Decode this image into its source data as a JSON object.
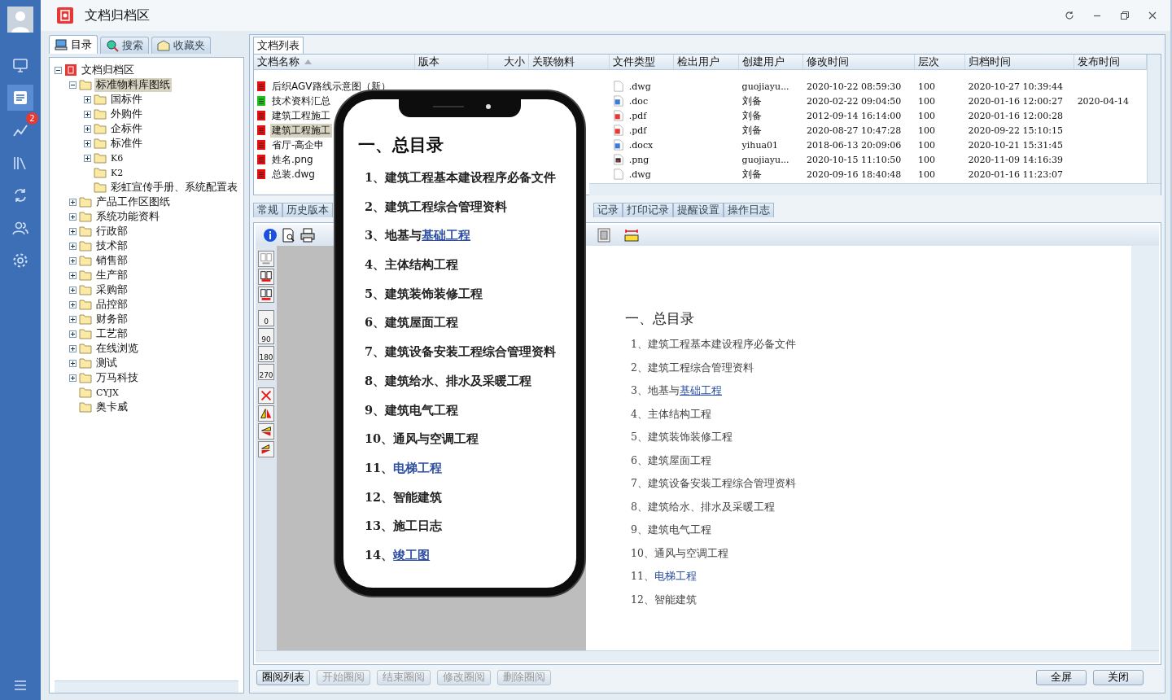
{
  "window": {
    "title": "文档归档区"
  },
  "sidebar": {
    "items": [
      {
        "kind": "monitor",
        "selected": false
      },
      {
        "kind": "documents",
        "selected": true
      },
      {
        "kind": "chart",
        "selected": false,
        "badge": "2"
      },
      {
        "kind": "books",
        "selected": false
      },
      {
        "kind": "exchange",
        "selected": false
      },
      {
        "kind": "users",
        "selected": false
      },
      {
        "kind": "settings",
        "selected": false
      }
    ]
  },
  "left_tabs": [
    {
      "label": "目录",
      "kind": "computer",
      "selected": true
    },
    {
      "label": "搜索",
      "kind": "search",
      "selected": false
    },
    {
      "label": "收藏夹",
      "kind": "favorites",
      "selected": false
    }
  ],
  "tree": [
    {
      "label": "文档归档区",
      "kind": "root",
      "expanded": true,
      "selected": false,
      "children": [
        {
          "label": "标准物料库图纸",
          "kind": "branch",
          "expanded": true,
          "selected": true,
          "children": [
            {
              "label": "国标件",
              "kind": "branch",
              "expanded": false,
              "selected": false
            },
            {
              "label": "外购件",
              "kind": "branch",
              "expanded": false,
              "selected": false
            },
            {
              "label": "企标件",
              "kind": "branch",
              "expanded": false,
              "selected": false
            },
            {
              "label": "标准件",
              "kind": "branch",
              "expanded": false,
              "selected": false
            },
            {
              "label": "K6",
              "kind": "branch",
              "expanded": false,
              "selected": false
            },
            {
              "label": "K2",
              "kind": "leaf",
              "selected": false
            },
            {
              "label": "彩虹宣传手册、系统配置表",
              "kind": "leaf",
              "selected": false
            }
          ]
        },
        {
          "label": "产品工作区图纸",
          "kind": "branch",
          "expanded": false,
          "selected": false
        },
        {
          "label": "系统功能资料",
          "kind": "branch",
          "expanded": false,
          "selected": false
        },
        {
          "label": "行政部",
          "kind": "branch",
          "expanded": false,
          "selected": false
        },
        {
          "label": "技术部",
          "kind": "branch",
          "expanded": false,
          "selected": false
        },
        {
          "label": "销售部",
          "kind": "branch",
          "expanded": false,
          "selected": false
        },
        {
          "label": "生产部",
          "kind": "branch",
          "expanded": false,
          "selected": false
        },
        {
          "label": "采购部",
          "kind": "branch",
          "expanded": false,
          "selected": false
        },
        {
          "label": "品控部",
          "kind": "branch",
          "expanded": false,
          "selected": false
        },
        {
          "label": "财务部",
          "kind": "branch",
          "expanded": false,
          "selected": false
        },
        {
          "label": "工艺部",
          "kind": "branch",
          "expanded": false,
          "selected": false
        },
        {
          "label": "在线浏览",
          "kind": "branch",
          "expanded": false,
          "selected": false
        },
        {
          "label": "测试",
          "kind": "branch",
          "expanded": false,
          "selected": false
        },
        {
          "label": "万马科技",
          "kind": "branch",
          "expanded": false,
          "selected": false
        },
        {
          "label": "CYJX",
          "kind": "leaf",
          "selected": false
        },
        {
          "label": "奥卡威",
          "kind": "leaf",
          "selected": false
        }
      ]
    }
  ],
  "file_list": {
    "tab": "文档列表",
    "columns": [
      {
        "label": "文档名称",
        "sorted": true
      },
      {
        "label": "版本",
        "sorted": false
      },
      {
        "label": "大小",
        "sorted": false
      },
      {
        "label": "关联物料",
        "sorted": false
      },
      {
        "label": "文件类型",
        "sorted": false
      },
      {
        "label": "检出用户",
        "sorted": false
      },
      {
        "label": "创建用户",
        "sorted": false
      },
      {
        "label": "修改时间",
        "sorted": false
      },
      {
        "label": "层次",
        "sorted": false
      },
      {
        "label": "归档时间",
        "sorted": false
      },
      {
        "label": "发布时间",
        "sorted": false
      }
    ],
    "rows": [
      {
        "name": "后织AGV路线示意图（新）",
        "color": "#e81010",
        "kind": "dwg",
        "type": ".dwg",
        "creator": "guojiayu...",
        "modified": "2020-10-22 08:59:30",
        "level_no": "100",
        "archived": "2020-10-27 10:39:44",
        "selected": false
      },
      {
        "name": "技术资料汇总",
        "color": "#22c01c",
        "kind": "doc",
        "type": ".doc",
        "creator": "刘备",
        "modified": "2020-02-22 09:04:50",
        "level_no": "100",
        "archived": "2020-01-16 12:00:27",
        "published": "2020-04-14",
        "selected": false
      },
      {
        "name": "建筑工程施工",
        "color": "#e81010",
        "kind": "pdf",
        "type": ".pdf",
        "creator": "刘备",
        "modified": "2012-09-14 16:14:00",
        "level_no": "100",
        "archived": "2020-01-16 12:00:28",
        "selected": false
      },
      {
        "name": "建筑工程施工",
        "color": "#e81010",
        "kind": "pdf",
        "type": ".pdf",
        "creator": "刘备",
        "modified": "2020-08-27 10:47:28",
        "level_no": "100",
        "archived": "2020-09-22 15:10:15",
        "selected": true
      },
      {
        "name": "省厅-高企申",
        "color": "#e81010",
        "kind": "doc",
        "type": ".docx",
        "creator": "yihua01",
        "modified": "2018-06-13 20:09:06",
        "level_no": "100",
        "archived": "2020-10-21 15:31:45",
        "selected": false
      },
      {
        "name": "姓名.png",
        "color": "#e81010",
        "kind": "png",
        "type": ".png",
        "creator": "guojiayu...",
        "modified": "2020-10-15 11:10:50",
        "level_no": "100",
        "archived": "2020-11-09 14:16:39",
        "selected": false
      },
      {
        "name": "总装.dwg",
        "color": "#e81010",
        "kind": "dwg",
        "type": ".dwg",
        "creator": "刘备",
        "modified": "2020-09-16 18:40:48",
        "level_no": "100",
        "archived": "2020-01-16 11:23:07",
        "selected": false
      }
    ]
  },
  "detail_tabs_left": [
    "常规",
    "历史版本"
  ],
  "detail_tabs_right": [
    "记录",
    "打印记录",
    "提醒设置",
    "操作日志"
  ],
  "rotate_tools": [
    "0",
    "90",
    "180",
    "270"
  ],
  "document": {
    "heading": "一、总目录",
    "items": [
      {
        "text": "1、建筑工程基本建设程序必备文件"
      },
      {
        "text": "2、建筑工程综合管理资料"
      },
      {
        "text": "3、地基与",
        "link": "基础工程",
        "underline": true
      },
      {
        "text": "4、主体结构工程"
      },
      {
        "text": "5、建筑装饰装修工程"
      },
      {
        "text": "6、建筑屋面工程"
      },
      {
        "text": "7、建筑设备安装工程综合管理资料"
      },
      {
        "text": "8、建筑给水、排水及采暖工程"
      },
      {
        "text": "9、建筑电气工程"
      },
      {
        "text": "10、通风与空调工程"
      },
      {
        "text": "11、",
        "link": "电梯工程",
        "underline": false
      },
      {
        "text": "12、智能建筑"
      }
    ]
  },
  "phone": {
    "heading": "一、总目录",
    "items": [
      {
        "text": "1、建筑工程基本建设程序必备文件"
      },
      {
        "text": "2、建筑工程综合管理资料"
      },
      {
        "text": "3、地基与",
        "link": "基础工程",
        "underline": true
      },
      {
        "text": "4、主体结构工程"
      },
      {
        "text": "5、建筑装饰装修工程"
      },
      {
        "text": "6、建筑屋面工程"
      },
      {
        "text": "7、建筑设备安装工程综合管理资料"
      },
      {
        "text": "8、建筑给水、排水及采暖工程"
      },
      {
        "text": "9、建筑电气工程"
      },
      {
        "text": "10、通风与空调工程"
      },
      {
        "text": "11、",
        "link": "电梯工程",
        "underline": false
      },
      {
        "text": "12、智能建筑"
      },
      {
        "text": "13、施工日志"
      },
      {
        "text": "14、",
        "link": "竣工图",
        "underline": true
      }
    ]
  },
  "buttons_left": [
    {
      "label": "圈阅列表",
      "disabled": false
    },
    {
      "label": "开始圈阅",
      "disabled": true
    },
    {
      "label": "结束圈阅",
      "disabled": true
    },
    {
      "label": "修改圈阅",
      "disabled": true
    },
    {
      "label": "删除圈阅",
      "disabled": true
    }
  ],
  "buttons_right": [
    {
      "label": "全屏",
      "disabled": false
    },
    {
      "label": "关闭",
      "disabled": false
    }
  ]
}
